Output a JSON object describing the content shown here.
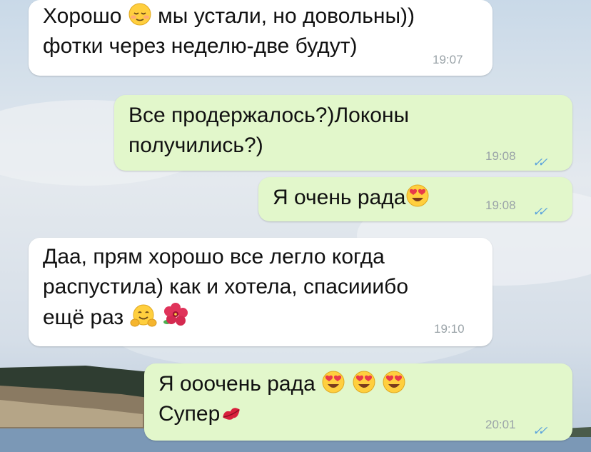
{
  "chat": {
    "messages": [
      {
        "direction": "incoming",
        "lines": [
          "Хорошо",
          "мы устали, но довольны))",
          "фотки через неделю-две будут)"
        ],
        "time": "19:07",
        "emojis": [
          "relieved-face"
        ]
      },
      {
        "direction": "outgoing",
        "lines": [
          "Все продержалось?)Локоны",
          "получились?)"
        ],
        "time": "19:08",
        "status": "read",
        "emojis": []
      },
      {
        "direction": "outgoing",
        "lines": [
          "Я очень рада"
        ],
        "time": "19:08",
        "status": "read",
        "emojis": [
          "heart-eyes-face"
        ]
      },
      {
        "direction": "incoming",
        "lines": [
          "Даа, прям хорошо все легло когда",
          "распустила) как и хотела, спасииибо",
          "ещё раз"
        ],
        "time": "19:10",
        "emojis": [
          "hugging-face",
          "hibiscus"
        ]
      },
      {
        "direction": "outgoing",
        "lines": [
          "Я ооочень рада",
          "Супер"
        ],
        "time": "20:01",
        "status": "read",
        "emojis": [
          "heart-eyes-face",
          "heart-eyes-face",
          "heart-eyes-face",
          "kiss-mark"
        ]
      }
    ]
  },
  "colors": {
    "incoming_bubble": "#ffffff",
    "outgoing_bubble": "#e2f7cb",
    "timestamp": "#9aa3a8",
    "read_ticks": "#5aa3dc"
  }
}
